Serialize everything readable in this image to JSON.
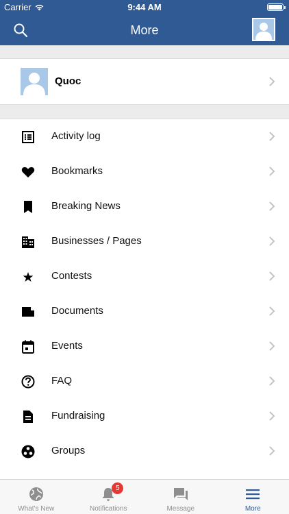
{
  "status_bar": {
    "carrier": "Carrier",
    "time": "9:44 AM",
    "battery_level": 1.0
  },
  "header": {
    "title": "More",
    "search_icon": "search-icon",
    "avatar_icon": "user-avatar-icon"
  },
  "profile": {
    "name": "Quoc"
  },
  "menu": {
    "items": [
      {
        "label": "Activity log",
        "icon": "activity-log-icon"
      },
      {
        "label": "Bookmarks",
        "icon": "heart-icon"
      },
      {
        "label": "Breaking News",
        "icon": "bookmark-icon"
      },
      {
        "label": "Businesses / Pages",
        "icon": "business-icon"
      },
      {
        "label": "Contests",
        "icon": "star-icon"
      },
      {
        "label": "Documents",
        "icon": "document-icon"
      },
      {
        "label": "Events",
        "icon": "calendar-icon"
      },
      {
        "label": "FAQ",
        "icon": "help-icon"
      },
      {
        "label": "Fundraising",
        "icon": "fundraising-icon"
      },
      {
        "label": "Groups",
        "icon": "groups-icon"
      }
    ]
  },
  "tabbar": {
    "tabs": [
      {
        "label": "What's New",
        "icon": "globe-icon",
        "active": false
      },
      {
        "label": "Notifications",
        "icon": "bell-icon",
        "active": false,
        "badge": "5"
      },
      {
        "label": "Message",
        "icon": "chat-icon",
        "active": false
      },
      {
        "label": "More",
        "icon": "menu-icon",
        "active": true
      }
    ]
  },
  "colors": {
    "brand": "#305a94",
    "badge": "#e53935",
    "inactive_tab": "#8e8e8e"
  }
}
